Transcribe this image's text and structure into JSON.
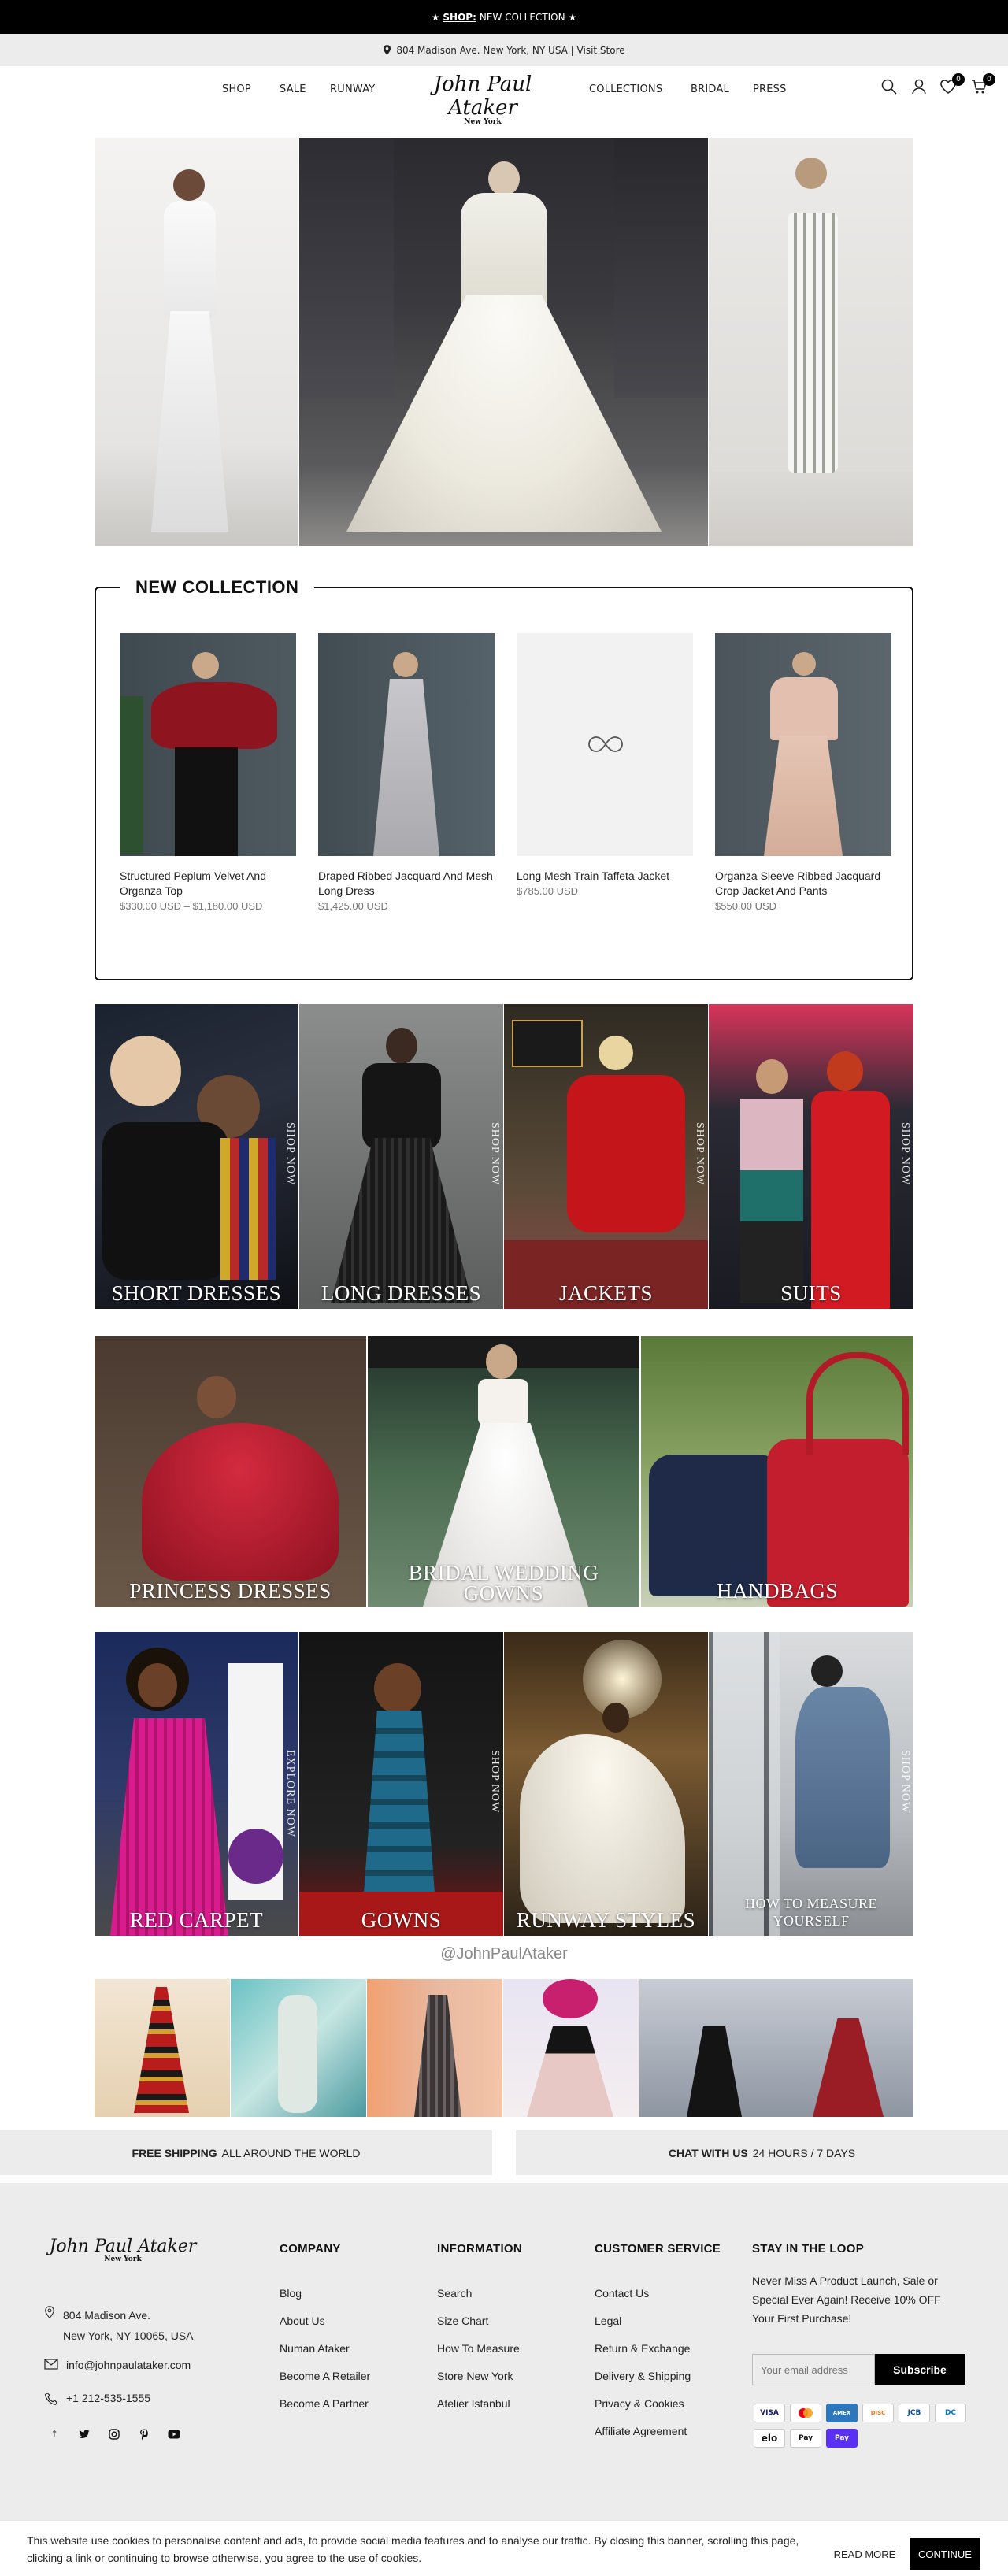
{
  "announcement": {
    "prefix": "★",
    "shop": "SHOP:",
    "text": "NEW COLLECTION",
    "suffix": "★"
  },
  "address_bar": {
    "text": "804 Madison Ave. New York, NY USA | Visit Store"
  },
  "header": {
    "nav_left": [
      "SHOP",
      "SALE",
      "RUNWAY"
    ],
    "nav_right": [
      "COLLECTIONS",
      "BRIDAL",
      "PRESS"
    ],
    "logo": "John Paul Ataker",
    "logo_sub": "New York",
    "wishlist_count": "0",
    "cart_count": "0"
  },
  "new_collection": {
    "title": "NEW COLLECTION",
    "products": [
      {
        "name": "Structured Peplum Velvet And Organza Top",
        "price": "$330.00 USD – $1,180.00 USD"
      },
      {
        "name": "Draped Ribbed Jacquard And Mesh Long Dress",
        "price": "$1,425.00 USD"
      },
      {
        "name": "Long Mesh Train Taffeta Jacket",
        "price": "$785.00 USD"
      },
      {
        "name": "Organza Sleeve Ribbed Jacquard Crop Jacket And Pants",
        "price": "$550.00 USD"
      }
    ]
  },
  "categories_row1": [
    {
      "label": "SHORT DRESSES",
      "side": "SHOP NOW"
    },
    {
      "label": "LONG DRESSES",
      "side": "SHOP NOW"
    },
    {
      "label": "JACKETS",
      "side": "SHOP NOW"
    },
    {
      "label": "SUITS",
      "side": "SHOP NOW"
    }
  ],
  "categories_row2": [
    {
      "label": "PRINCESS DRESSES"
    },
    {
      "label": "BRIDAL WEDDING GOWNS"
    },
    {
      "label": "HANDBAGS"
    }
  ],
  "categories_row3": [
    {
      "label": "RED CARPET",
      "side": "EXPLORE NOW"
    },
    {
      "label": "GOWNS",
      "side": "SHOP NOW"
    },
    {
      "label": "RUNWAY STYLES",
      "side": ""
    },
    {
      "label": "HOW TO MEASURE YOURSELF",
      "side": "SHOP NOW"
    }
  ],
  "instagram": {
    "handle": "@JohnPaulAtaker"
  },
  "bands": {
    "shipping_bold": "FREE SHIPPING",
    "shipping_rest": "ALL AROUND THE WORLD",
    "chat_bold": "CHAT WITH US",
    "chat_rest": "24 HOURS / 7 DAYS"
  },
  "footer": {
    "logo": "John Paul Ataker",
    "logo_sub": "New York",
    "address_line1": "804 Madison Ave.",
    "address_line2": "New York, NY 10065, USA",
    "email": "info@johnpaulataker.com",
    "phone": "+1 212-535-1555",
    "company": {
      "title": "COMPANY",
      "links": [
        "Blog",
        "About Us",
        "Numan Ataker",
        "Become A Retailer",
        "Become A Partner"
      ]
    },
    "information": {
      "title": "INFORMATION",
      "links": [
        "Search",
        "Size Chart",
        "How To Measure",
        "Store New York",
        "Atelier Istanbul"
      ]
    },
    "customer_service": {
      "title": "CUSTOMER SERVICE",
      "links": [
        "Contact Us",
        "Legal",
        "Return & Exchange",
        "Delivery & Shipping",
        "Privacy & Cookies",
        "Affiliate Agreement"
      ]
    },
    "newsletter": {
      "title": "STAY IN THE LOOP",
      "text": "Never Miss A Product Launch, Sale or Special Ever Again! Receive 10% OFF Your First Purchase!",
      "placeholder": "Your email address",
      "button": "Subscribe"
    },
    "payments": [
      "VISA",
      "MC",
      "AMEX",
      "DISC",
      "JCB",
      "DC",
      "elo",
      "Pay",
      "Pay"
    ]
  },
  "cookie": {
    "text": "This website use cookies to personalise content and ads, to provide social media features and to analyse our traffic. By closing this banner, scrolling this page, clicking a link or continuing to browse otherwise, you agree to the use of cookies.",
    "read_more": "READ MORE",
    "continue": "CONTINUE"
  }
}
